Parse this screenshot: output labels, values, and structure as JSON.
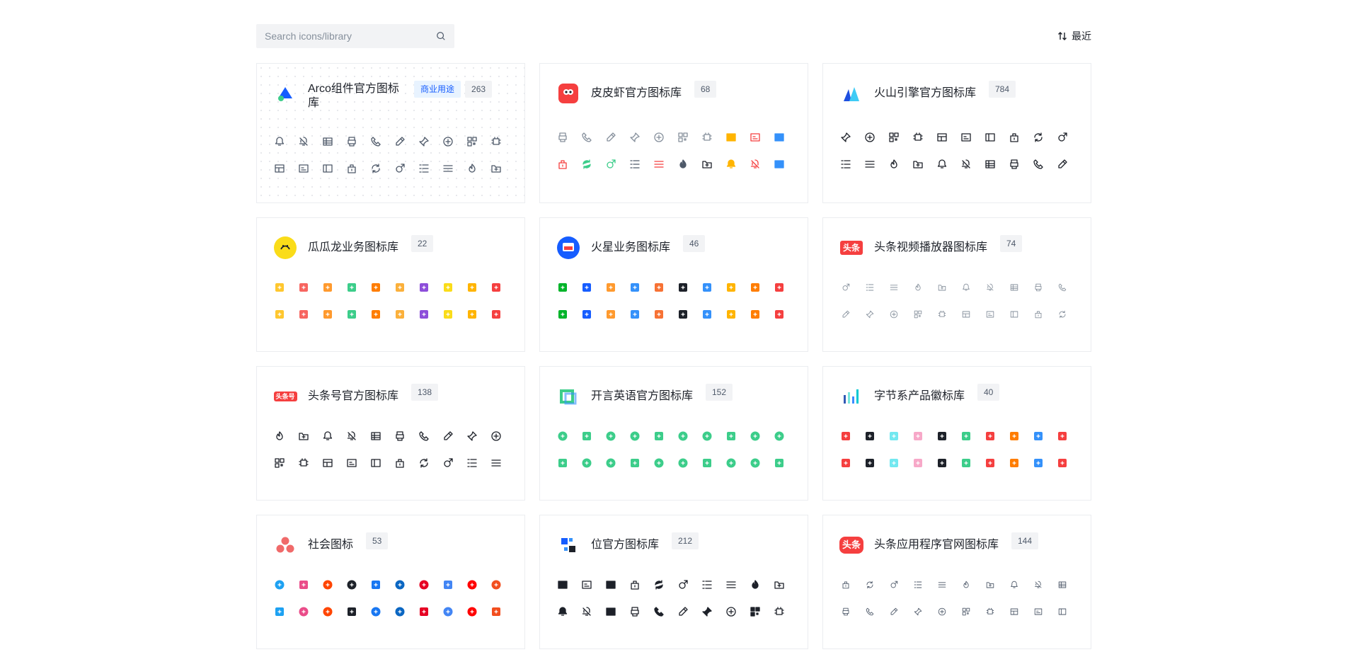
{
  "search": {
    "placeholder": "Search icons/library"
  },
  "sort": {
    "label": "最近",
    "icon": "sort-icon"
  },
  "cards": [
    {
      "name": "Arco组件官方图标库",
      "tag": "商业用途",
      "count": "263",
      "logo": "arco-logo",
      "style": "outline",
      "color": "#4e5969"
    },
    {
      "name": "皮皮虾官方图标库",
      "count": "68",
      "logo": "pipixia-logo",
      "style": "outline-color",
      "color": "#86909c"
    },
    {
      "name": "火山引擎官方图标库",
      "count": "784",
      "logo": "volcano-logo",
      "style": "outline",
      "color": "#1d2129"
    },
    {
      "name": "瓜瓜龙业务图标库",
      "count": "22",
      "logo": "guagualong-logo",
      "style": "color-small",
      "color": "#ff7d00"
    },
    {
      "name": "火星业务图标库",
      "count": "46",
      "logo": "mars-logo",
      "style": "file-color",
      "color": "#165dff"
    },
    {
      "name": "头条视频播放器图标库",
      "count": "74",
      "logo": "toutiao-logo",
      "style": "outline-small",
      "color": "#86909c"
    },
    {
      "name": "头条号官方图标库",
      "count": "138",
      "logo": "toutiaohao-logo",
      "style": "outline",
      "color": "#1d2129"
    },
    {
      "name": "开言英语官方图标库",
      "count": "152",
      "logo": "kaiyan-logo",
      "style": "green",
      "color": "#3ccd8a"
    },
    {
      "name": "字节系产品徽标库",
      "count": "40",
      "logo": "bytedance-logo",
      "style": "brand",
      "color": "#165dff"
    },
    {
      "name": "社会图标",
      "count": "53",
      "logo": "social-logo",
      "style": "social",
      "color": "#1877f2"
    },
    {
      "name": "位官方图标库",
      "count": "212",
      "logo": "wei-logo",
      "style": "solid",
      "color": "#1d2129"
    },
    {
      "name": "头条应用程序官网图标库",
      "count": "144",
      "logo": "toutiao-app-logo",
      "style": "outline-small",
      "color": "#4e5969"
    }
  ],
  "toutiao_logo_text": "头条",
  "toutiaohao_logo_text": "头条号",
  "colors": {
    "accent": "#165dff",
    "border": "#ebedf0",
    "badge_bg": "#f2f3f5",
    "red": "#f53f3f",
    "green": "#3ccd8a"
  }
}
